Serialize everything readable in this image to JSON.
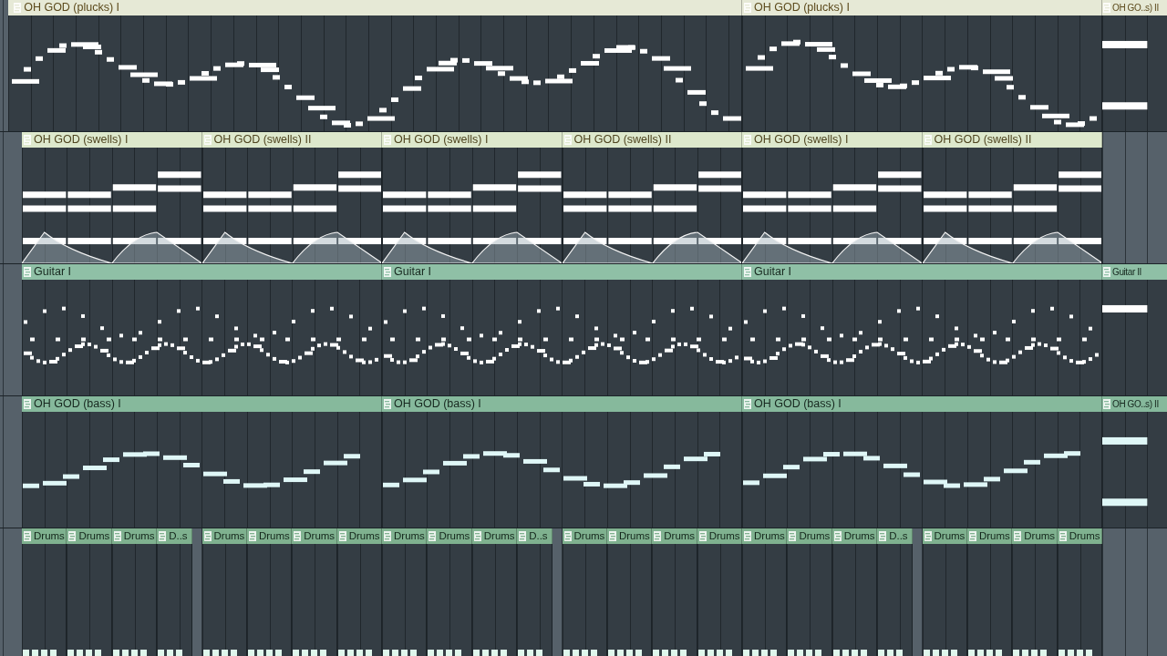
{
  "tracks": [
    {
      "kind": "pluck",
      "clips": [
        {
          "label": "OH GOD (plucks) I"
        },
        {
          "label": "OH GOD (plucks) I"
        },
        {
          "label": "OH GO..s) II"
        }
      ]
    },
    {
      "kind": "swell",
      "clips": [
        {
          "label": "OH GOD (swells) I"
        },
        {
          "label": "OH GOD (swells) II"
        },
        {
          "label": "OH GOD (swells) I"
        },
        {
          "label": "OH GOD (swells) II"
        },
        {
          "label": "OH GOD (swells) I"
        },
        {
          "label": "OH GOD (swells) II"
        }
      ]
    },
    {
      "kind": "guitar",
      "clips": [
        {
          "label": "Guitar I"
        },
        {
          "label": "Guitar I"
        },
        {
          "label": "Guitar I"
        },
        {
          "label": "Guitar II"
        }
      ]
    },
    {
      "kind": "bass",
      "clips": [
        {
          "label": "OH GOD (bass) I"
        },
        {
          "label": "OH GOD (bass) I"
        },
        {
          "label": "OH GOD (bass) I"
        },
        {
          "label": "OH GO..s) II"
        }
      ]
    },
    {
      "kind": "drum",
      "clips": [
        {
          "label": "Drums"
        },
        {
          "label": "Drums"
        },
        {
          "label": "Drums"
        },
        {
          "label": "D..s"
        },
        {
          "label": "Drums"
        },
        {
          "label": "Drums"
        },
        {
          "label": "Drums"
        },
        {
          "label": "Drums"
        },
        {
          "label": "Drums"
        },
        {
          "label": "Drums"
        },
        {
          "label": "Drums"
        },
        {
          "label": "D..s"
        },
        {
          "label": "Drums"
        },
        {
          "label": "Drums"
        },
        {
          "label": "Drums"
        },
        {
          "label": "Drums"
        },
        {
          "label": "Drums"
        },
        {
          "label": "Drums"
        },
        {
          "label": "Drums"
        },
        {
          "label": "D..s"
        },
        {
          "label": "Drums"
        },
        {
          "label": "Drums"
        },
        {
          "label": "Drums"
        },
        {
          "label": "Drums"
        }
      ]
    }
  ]
}
